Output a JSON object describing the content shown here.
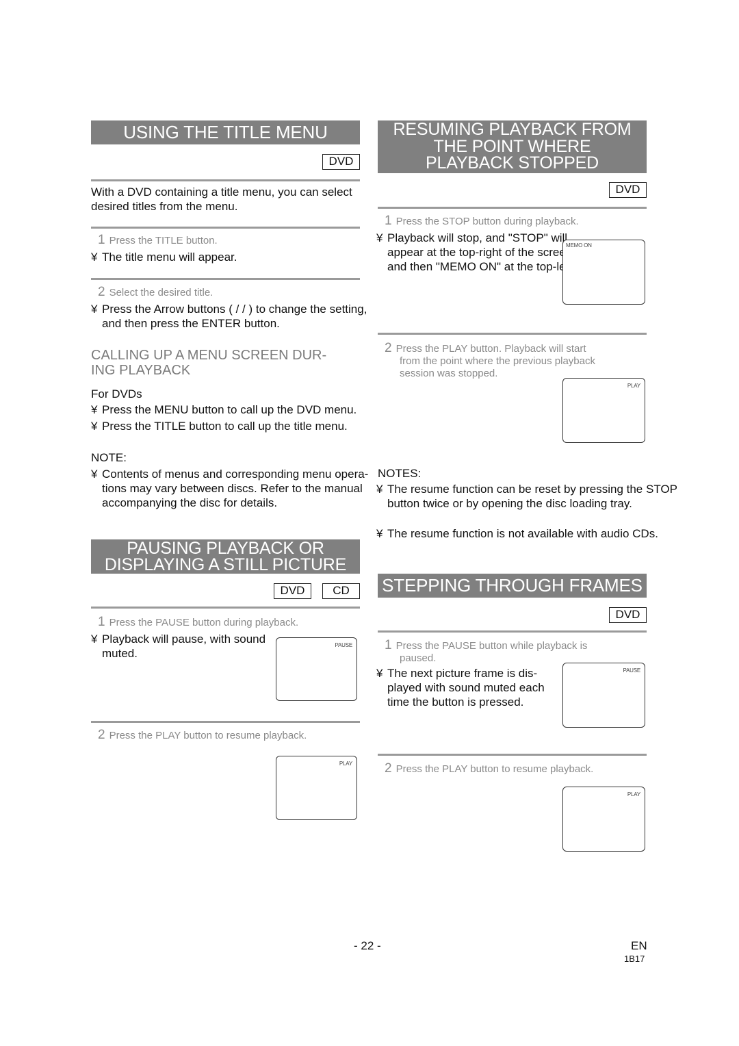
{
  "left": {
    "title_menu": {
      "title": "USING THE TITLE MENU",
      "badges": [
        "DVD"
      ],
      "intro": "With a DVD containing a title menu, you can select desired titles from the menu.",
      "steps": [
        {
          "num": "1",
          "text": "Press the TITLE button.",
          "bullets": [
            "The title menu will appear."
          ]
        },
        {
          "num": "2",
          "text": "Select the desired title.",
          "bullets": [
            "Press the Arrow buttons (  /  /  ) to change the setting, and then press the ENTER button."
          ]
        }
      ],
      "sub": {
        "title_line1": "CALLING UP A MENU SCREEN DUR-",
        "title_line2": "ING PLAYBACK",
        "for_label": "For DVDs",
        "bullets": [
          "Press the MENU button to call up the DVD menu.",
          "Press the TITLE button to call up the title menu."
        ]
      },
      "note": {
        "label": "NOTE:",
        "bullets": [
          "Contents of menus and corresponding menu opera-tions may vary between discs. Refer to the manual accompanying the disc for details."
        ]
      }
    },
    "pausing": {
      "title_line1": "PAUSING PLAYBACK OR",
      "title_line2": "DISPLAYING A STILL PICTURE",
      "badges": [
        "DVD",
        "CD"
      ],
      "steps": [
        {
          "num": "1",
          "text": "Press the PAUSE button during playback.",
          "bullets": [
            "Playback will pause, with sound muted."
          ],
          "screen_label": "PAUSE"
        },
        {
          "num": "2",
          "text": "Press the PLAY button to resume playback.",
          "screen_label": "PLAY"
        }
      ]
    }
  },
  "right": {
    "resuming": {
      "title_line1": "RESUMING PLAYBACK FROM",
      "title_line2": "THE POINT WHERE",
      "title_line3": "PLAYBACK STOPPED",
      "badges": [
        "DVD"
      ],
      "steps": [
        {
          "num": "1",
          "text": "Press the STOP button during playback.",
          "bullets": [
            "Playback will stop, and \"STOP\" will appear at the top-right of the screen and then \"MEMO ON\" at the top-left."
          ],
          "screen_label": "MEMO ON"
        },
        {
          "num": "2",
          "text_line1": "Press the PLAY button. Playback will start",
          "text_line2": "from the point where the previous playback",
          "text_line3": "session was stopped.",
          "screen_label": "PLAY"
        }
      ],
      "notes": {
        "label": "NOTES:",
        "bullets": [
          "The resume function can be reset by pressing the STOP button twice or by opening the disc loading tray.",
          "The resume function is not available with audio CDs."
        ]
      }
    },
    "stepping": {
      "title": "STEPPING THROUGH FRAMES",
      "badges": [
        "DVD"
      ],
      "steps": [
        {
          "num": "1",
          "text_line1": "Press the PAUSE button while playback is",
          "text_line2": "paused.",
          "bullets": [
            "The next picture frame is dis-played with sound muted each time the button is pressed."
          ],
          "screen_label": "PAUSE"
        },
        {
          "num": "2",
          "text": "Press the PLAY button to resume playback.",
          "screen_label": "PLAY"
        }
      ]
    }
  },
  "bullet_glyph": "¥",
  "footer": {
    "page_number": "- 22 -",
    "language": "EN",
    "code": "1B17"
  }
}
